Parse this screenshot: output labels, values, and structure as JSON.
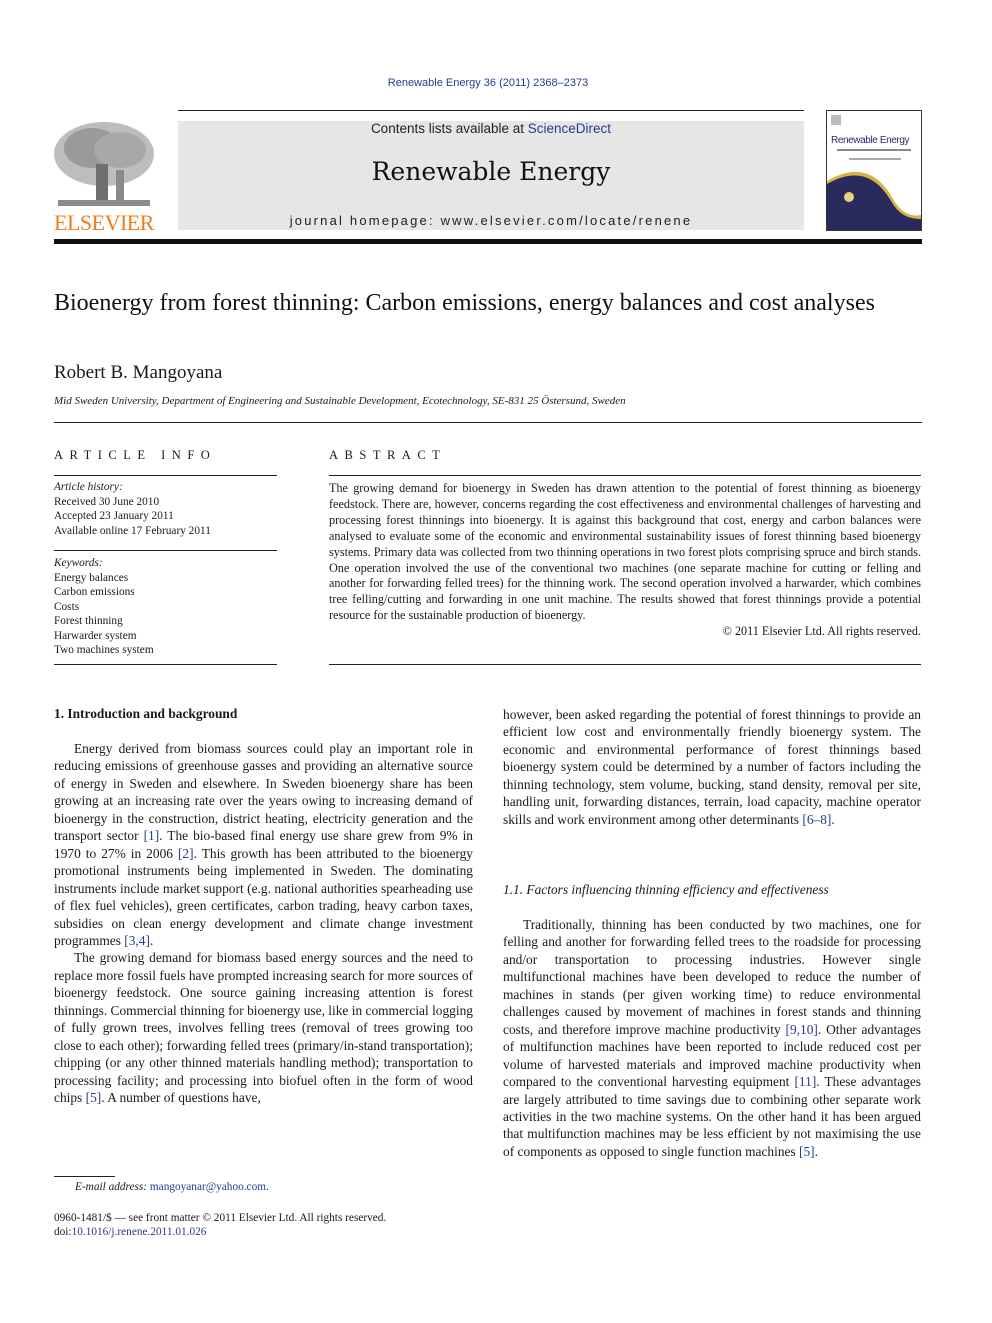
{
  "header": {
    "citation": "Renewable Energy 36 (2011) 2368–2373",
    "contents_prefix": "Contents lists available at ",
    "contents_link": "ScienceDirect",
    "journal_title": "Renewable Energy",
    "homepage": "journal homepage: www.elsevier.com/locate/renene",
    "publisher_logo_text": "ELSEVIER",
    "cover_title": "Renewable Energy",
    "colors": {
      "link": "#2a3a8c",
      "elsevier_orange": "#f07d1a",
      "banner_bg": "#e6e6e6",
      "cover_navy": "#2b2a5e",
      "cover_gold": "#d8b444"
    }
  },
  "article": {
    "title": "Bioenergy from forest thinning: Carbon emissions, energy balances and cost analyses",
    "author": "Robert B. Mangoyana",
    "affiliation": "Mid Sweden University, Department of Engineering and Sustainable Development, Ecotechnology, SE-831 25 Östersund, Sweden"
  },
  "article_info": {
    "heading": "ARTICLE INFO",
    "history_label": "Article history:",
    "history": [
      "Received 30 June 2010",
      "Accepted 23 January 2011",
      "Available online 17 February 2011"
    ],
    "keywords_label": "Keywords:",
    "keywords": [
      "Energy balances",
      "Carbon emissions",
      "Costs",
      "Forest thinning",
      "Harwarder system",
      "Two machines system"
    ]
  },
  "abstract": {
    "heading": "ABSTRACT",
    "text": "The growing demand for bioenergy in Sweden has drawn attention to the potential of forest thinning as bioenergy feedstock. There are, however, concerns regarding the cost effectiveness and environmental challenges of harvesting and processing forest thinnings into bioenergy. It is against this background that cost, energy and carbon balances were analysed to evaluate some of the economic and environmental sustainability issues of forest thinning based bioenergy systems. Primary data was collected from two thinning operations in two forest plots comprising spruce and birch stands. One operation involved the use of the conventional two machines (one separate machine for cutting or felling and another for forwarding felled trees) for the thinning work. The second operation involved a harwarder, which combines tree felling/cutting and forwarding in one unit machine. The results showed that forest thinnings provide a potential resource for the sustainable production of bioenergy.",
    "copyright": "© 2011 Elsevier Ltd. All rights reserved."
  },
  "body": {
    "section1_heading": "1.  Introduction and background",
    "p1_a": "Energy derived from biomass sources could play an important role in reducing emissions of greenhouse gasses and providing an alternative source of energy in Sweden and elsewhere. In Sweden bioenergy share has been growing at an increasing rate over the years owing to increasing demand of bioenergy in the construction, district heating, electricity generation and the transport sector ",
    "p1_ref1": "[1]",
    "p1_b": ". The bio-based final energy use share grew from 9% in 1970 to 27% in 2006 ",
    "p1_ref2": "[2]",
    "p1_c": ". This growth has been attributed to the bioenergy promotional instruments being implemented in Sweden. The dominating instruments include market support (e.g. national authorities spearheading use of flex fuel vehicles), green certificates, carbon trading, heavy carbon taxes, subsidies on clean energy development and climate change investment programmes ",
    "p1_ref3": "[3,4]",
    "p1_d": ".",
    "p2_a": "The growing demand for biomass based energy sources and the need to replace more fossil fuels have prompted increasing search for more sources of bioenergy feedstock. One source gaining increasing attention is forest thinnings. Commercial thinning for bioenergy use, like in commercial logging of fully grown trees, involves felling trees (removal of trees growing too close to each other); forwarding felled trees (primary/in-stand transportation); chipping (or any other thinned materials handling method); transportation to processing facility; and processing into biofuel often in the form of wood chips ",
    "p2_ref1": "[5]",
    "p2_b": ". A number of questions have,",
    "p3_a": "however, been asked regarding the potential of forest thinnings to provide an efficient low cost and environmentally friendly bioenergy system. The economic and environmental performance of forest thinnings based bioenergy system could be determined by a number of factors including the thinning technology, stem volume, bucking, stand density, removal per site, handling unit, forwarding distances, terrain, load capacity, machine operator skills and work environment among other determinants ",
    "p3_ref1": "[6–8]",
    "p3_b": ".",
    "section11_heading": "1.1.  Factors influencing thinning efficiency and effectiveness",
    "p4_a": "Traditionally, thinning has been conducted by two machines, one for felling and another for forwarding felled trees to the roadside for processing and/or transportation to processing industries. However single multifunctional machines have been developed to reduce the number of machines in stands (per given working time) to reduce environmental challenges caused by movement of machines in forest stands and thinning costs, and therefore improve machine productivity ",
    "p4_ref1": "[9,10]",
    "p4_b": ". Other advantages of multifunction machines have been reported to include reduced cost per volume of harvested materials and improved machine productivity when compared to the conventional harvesting equipment ",
    "p4_ref2": "[11]",
    "p4_c": ". These advantages are largely attributed to time savings due to combining other separate work activities in the two machine systems. On the other hand it has been argued that multifunction machines may be less efficient by not maximising the use of components as opposed to single function machines ",
    "p4_ref3": "[5]",
    "p4_d": "."
  },
  "footer": {
    "email_label": "E-mail address: ",
    "email": "mangoyanar@yahoo.com",
    "email_end": ".",
    "issn_line": "0960-1481/$ — see front matter © 2011 Elsevier Ltd. All rights reserved.",
    "doi_label": "doi:",
    "doi": "10.1016/j.renene.2011.01.026"
  }
}
